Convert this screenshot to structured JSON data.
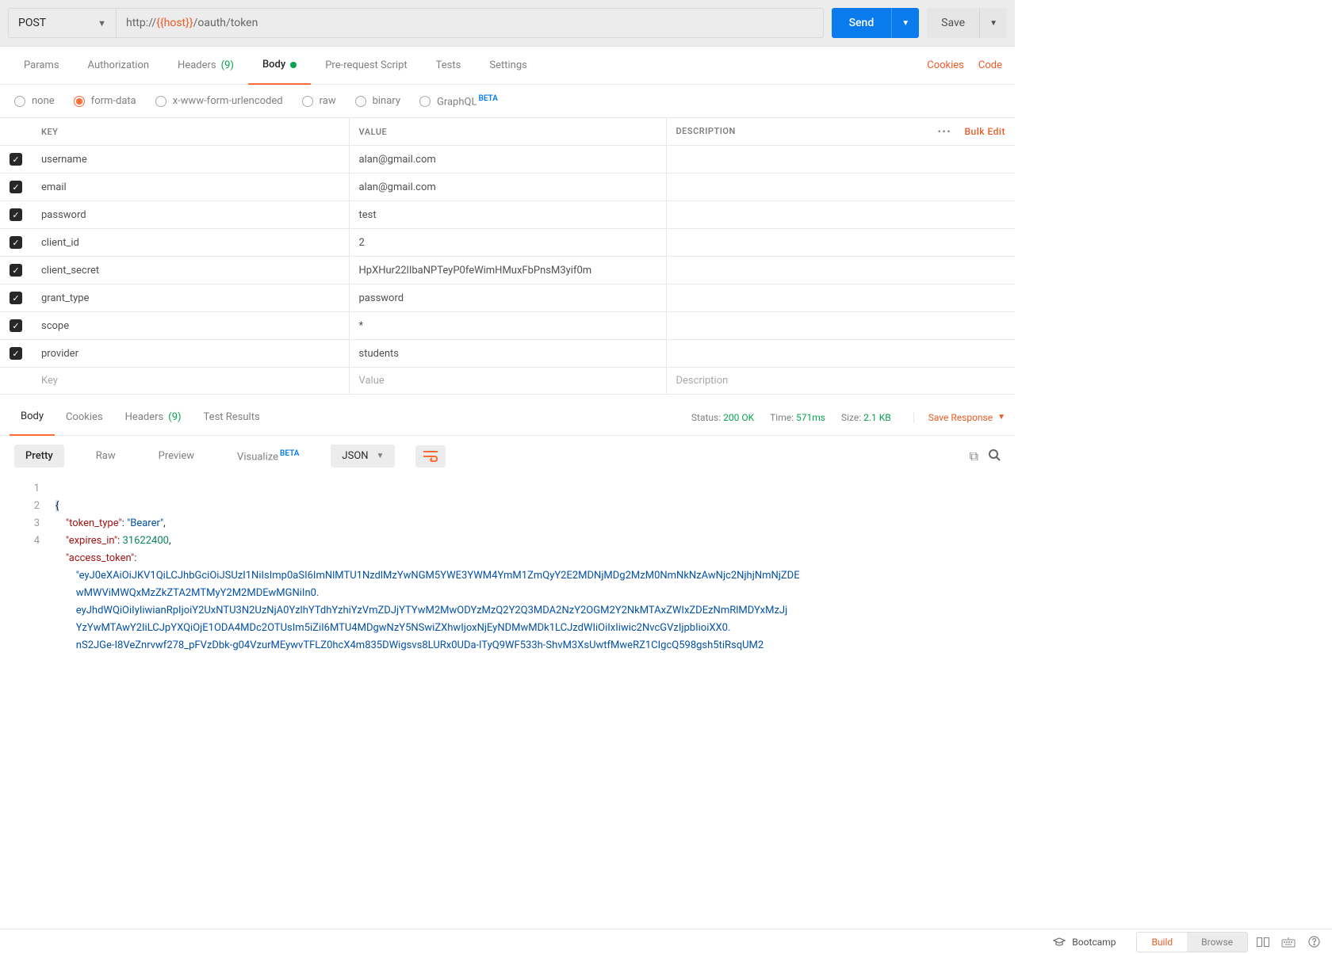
{
  "request": {
    "method": "POST",
    "url_prefix": "http://",
    "url_host_var": "{{host}}",
    "url_suffix": "/oauth/token"
  },
  "buttons": {
    "send": "Send",
    "save": "Save"
  },
  "tabs": {
    "params": "Params",
    "auth": "Authorization",
    "headers": "Headers",
    "headers_count": "(9)",
    "body": "Body",
    "prereq": "Pre-request Script",
    "tests": "Tests",
    "settings": "Settings"
  },
  "right_links": {
    "cookies": "Cookies",
    "code": "Code"
  },
  "body_types": {
    "none": "none",
    "formdata": "form-data",
    "urlencoded": "x-www-form-urlencoded",
    "raw": "raw",
    "binary": "binary",
    "graphql": "GraphQL",
    "beta": "BETA"
  },
  "kv": {
    "header_key": "KEY",
    "header_value": "VALUE",
    "header_desc": "DESCRIPTION",
    "bulk_edit": "Bulk Edit",
    "placeholder_key": "Key",
    "placeholder_value": "Value",
    "placeholder_desc": "Description",
    "rows": [
      {
        "k": "username",
        "v": "alan@gmail.com"
      },
      {
        "k": "email",
        "v": "alan@gmail.com"
      },
      {
        "k": "password",
        "v": "test"
      },
      {
        "k": "client_id",
        "v": "2"
      },
      {
        "k": "client_secret",
        "v": "HpXHur22lIbaNPTeyP0feWimHMuxFbPnsM3yif0m"
      },
      {
        "k": "grant_type",
        "v": "password"
      },
      {
        "k": "scope",
        "v": "*"
      },
      {
        "k": "provider",
        "v": "students"
      }
    ]
  },
  "response_tabs": {
    "body": "Body",
    "cookies": "Cookies",
    "headers": "Headers",
    "headers_count": "(9)",
    "test_results": "Test Results"
  },
  "response_meta": {
    "status_label": "Status:",
    "status_value": "200 OK",
    "time_label": "Time:",
    "time_value": "571ms",
    "size_label": "Size:",
    "size_value": "2.1 KB",
    "save_response": "Save Response"
  },
  "response_toolbar": {
    "pretty": "Pretty",
    "raw": "Raw",
    "preview": "Preview",
    "visualize": "Visualize",
    "beta": "BETA",
    "lang": "JSON"
  },
  "response_json": {
    "token_type_key": "\"token_type\"",
    "token_type_val": "\"Bearer\"",
    "expires_key": "\"expires_in\"",
    "expires_val": "31622400",
    "access_key": "\"access_token\"",
    "access_val_l1": "\"eyJ0eXAiOiJKV1QiLCJhbGciOiJSUzI1NiIsImp0aSI6ImNlMTU1NzdlMzYwNGM5YWE3YWM4YmM1ZmQyY2E2MDNjMDg2MzM0NmNkNzAwNjc2NjhjNmNjZDE",
    "access_val_l2": "wMWViMWQxMzZkZTA2MTMyY2M2MDEwMGNiIn0.",
    "access_val_l3": "eyJhdWQiOiIyIiwianRpIjoiY2UxNTU3N2UzNjA0YzlhYTdhYzhiYzVmZDJjYTYwM2MwODYzMzQ2Y2Q3MDA2NzY2OGM2Y2NkMTAxZWIxZDEzNmRlMDYxMzJj",
    "access_val_l4": "YzYwMTAwY2IiLCJpYXQiOjE1ODA4MDc2OTUsIm5iZiI6MTU4MDgwNzY5NSwiZXhwIjoxNjEyNDMwMDk1LCJzdWIiOiIxIiwic2NvcGVzIjpbIioiXX0.",
    "access_val_l5": "nS2JGe-I8VeZnrvwf278_pFVzDbk-g04VzurMEywvTFLZ0hcX4m835DWigsvs8LURx0UDa-lTyQ9WF533h-ShvM3XsUwtfMweRZ1CIgcQ598gsh5tiRsqUM2"
  },
  "footer": {
    "bootcamp": "Bootcamp",
    "build": "Build",
    "browse": "Browse"
  }
}
